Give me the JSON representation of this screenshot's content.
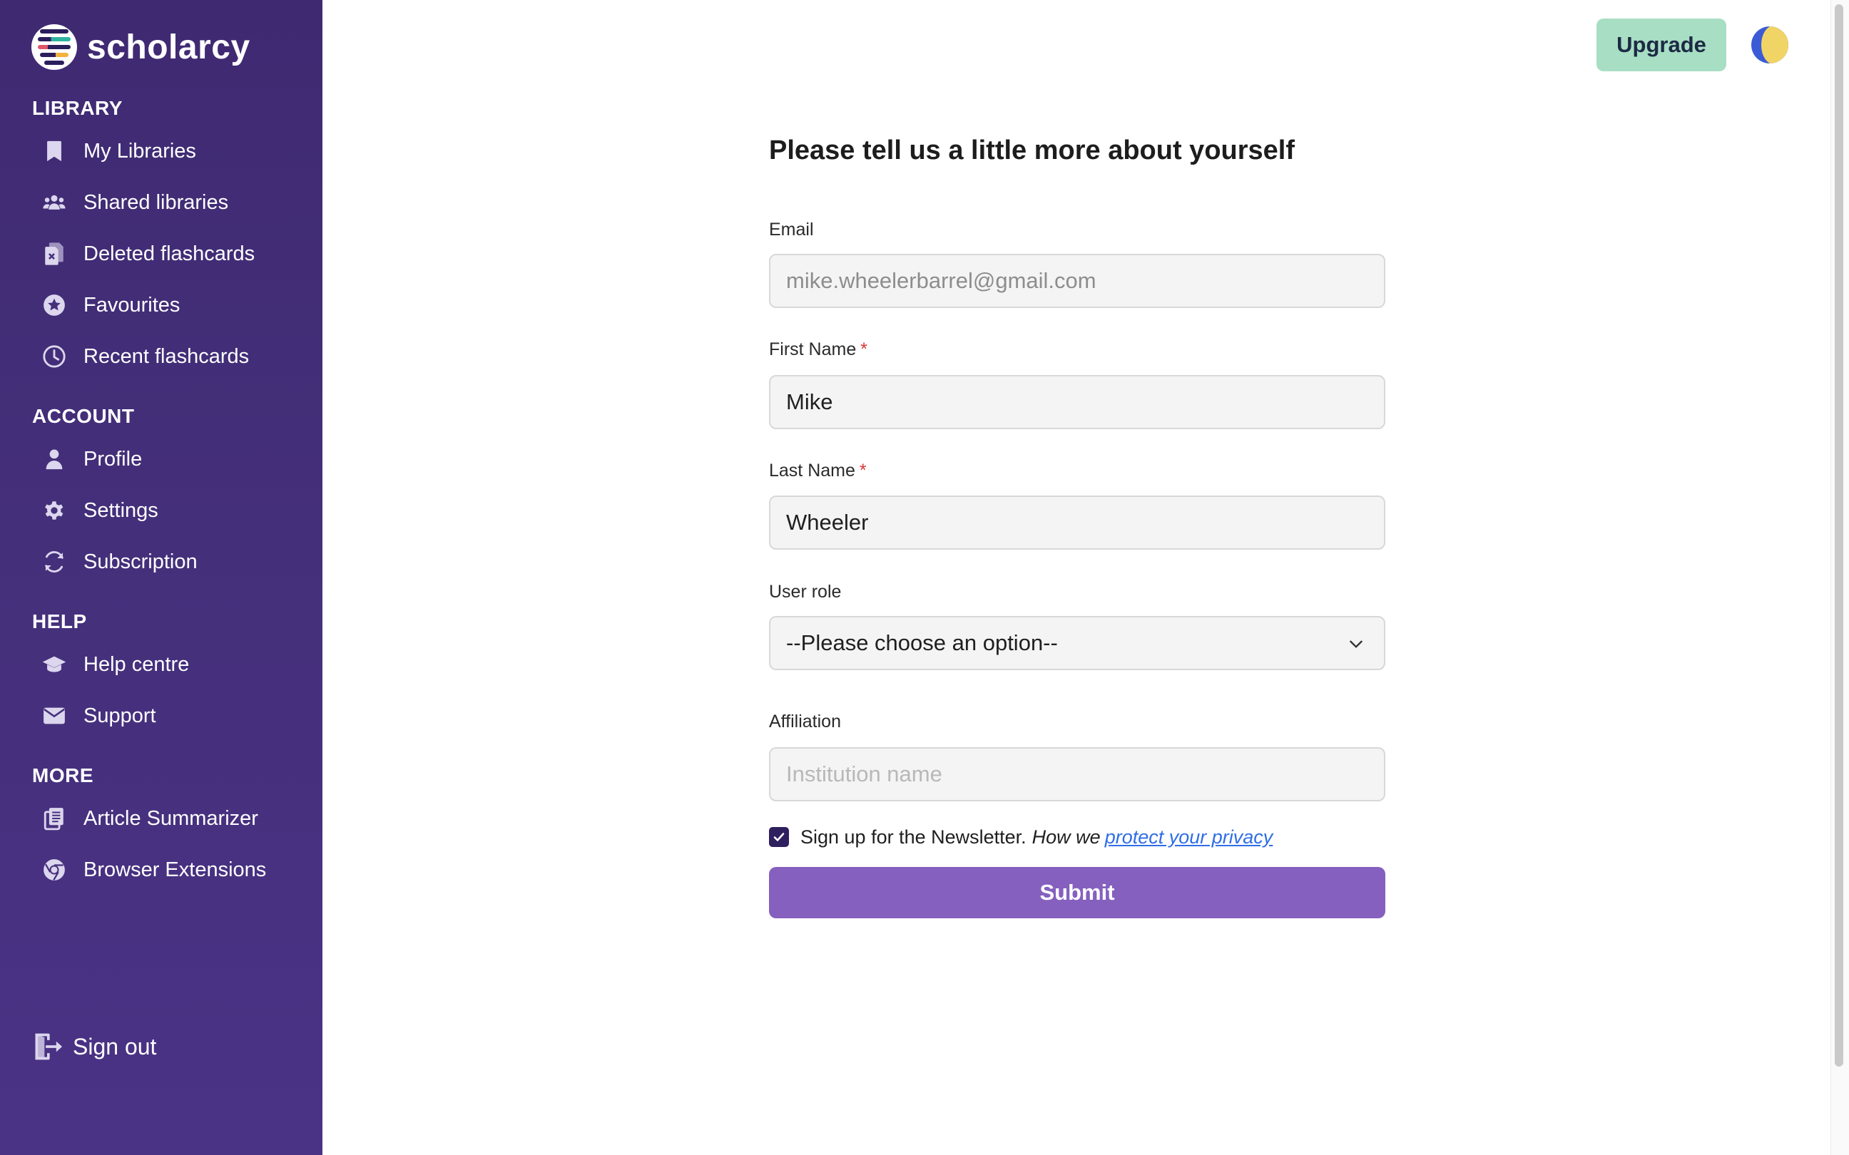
{
  "app": {
    "name": "scholarcy"
  },
  "sidebar": {
    "sections": {
      "library": "LIBRARY",
      "account": "ACCOUNT",
      "help": "HELP",
      "more": "MORE"
    },
    "library_items": [
      {
        "label": "My Libraries",
        "icon": "bookmark-icon"
      },
      {
        "label": "Shared libraries",
        "icon": "users-icon"
      },
      {
        "label": "Deleted flashcards",
        "icon": "deleted-file-icon"
      },
      {
        "label": "Favourites",
        "icon": "star-circle-icon"
      },
      {
        "label": "Recent flashcards",
        "icon": "clock-icon"
      }
    ],
    "account_items": [
      {
        "label": "Profile",
        "icon": "user-icon"
      },
      {
        "label": "Settings",
        "icon": "gear-icon"
      },
      {
        "label": "Subscription",
        "icon": "refresh-icon"
      }
    ],
    "help_items": [
      {
        "label": "Help centre",
        "icon": "graduation-cap-icon"
      },
      {
        "label": "Support",
        "icon": "envelope-icon"
      }
    ],
    "more_items": [
      {
        "label": "Article Summarizer",
        "icon": "documents-icon"
      },
      {
        "label": "Browser Extensions",
        "icon": "chrome-icon"
      }
    ],
    "sign_out": "Sign out"
  },
  "header": {
    "upgrade_label": "Upgrade",
    "theme_icon": "half-moon-icon"
  },
  "form": {
    "title": "Please tell us a little more about yourself",
    "email": {
      "label": "Email",
      "value": "mike.wheelerbarrel@gmail.com"
    },
    "first_name": {
      "label": "First Name",
      "required_mark": "*",
      "value": "Mike"
    },
    "last_name": {
      "label": "Last Name",
      "required_mark": "*",
      "value": "Wheeler"
    },
    "user_role": {
      "label": "User role",
      "selected": "--Please choose an option--"
    },
    "affiliation": {
      "label": "Affiliation",
      "placeholder": "Institution name",
      "value": ""
    },
    "newsletter": {
      "checked": true,
      "label": "Sign up for the Newsletter.",
      "privacy_prefix": "How we",
      "privacy_link": "protect your privacy"
    },
    "submit_label": "Submit"
  },
  "colors": {
    "sidebar": "#45307c",
    "upgrade": "#a8dec3",
    "submit": "#8560be",
    "link": "#2f6ee6",
    "required": "#dd3333"
  }
}
